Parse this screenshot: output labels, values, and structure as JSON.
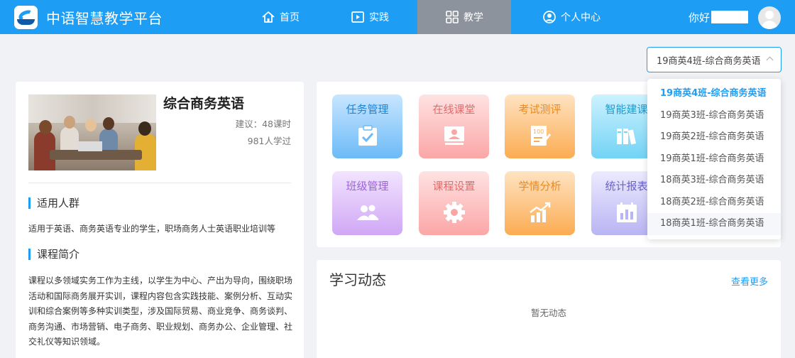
{
  "brand": {
    "title": "中语智慧教学平台",
    "logo_icon": "platform-logo"
  },
  "nav": [
    {
      "label": "首页",
      "icon": "home-icon"
    },
    {
      "label": "实践",
      "icon": "play-icon"
    },
    {
      "label": "教学",
      "icon": "grid-icon",
      "active": true
    },
    {
      "label": "个人中心",
      "icon": "user-circle-icon"
    }
  ],
  "user": {
    "greeting": "你好"
  },
  "class_select": {
    "value": "19商英4班-综合商务英语",
    "options": [
      "19商英4班-综合商务英语",
      "19商英3班-综合商务英语",
      "19商英2班-综合商务英语",
      "19商英1班-综合商务英语",
      "18商英3班-综合商务英语",
      "18商英2班-综合商务英语",
      "18商英1班-综合商务英语"
    ],
    "hovered_option": "18商英1班-综合商务英语"
  },
  "course": {
    "title": "综合商务英语",
    "hours": "建议：48课时",
    "learners": "981人学过",
    "audience_heading": "适用人群",
    "audience_text": "适用于英语、商务英语专业的学生，职场商务人士英语职业培训等",
    "intro_heading": "课程简介",
    "intro_text": "课程以多领域实务工作为主线，以学生为中心、产出为导向，围绕职场活动和国际商务展开实训，课程内容包含实践技能、案例分析、互动实训和综合案例等多种实训类型，涉及国际贸易、商业竞争、商务谈判、商务沟通、市场营销、电子商务、职业规划、商务办公、企业管理、社交礼仪等知识领域。"
  },
  "tools": [
    {
      "label": "任务管理",
      "icon": "clipboard-check-icon",
      "color": "#1a84d8"
    },
    {
      "label": "在线课堂",
      "icon": "online-class-icon",
      "color": "#e26b6b"
    },
    {
      "label": "考试测评",
      "icon": "exam-score-icon",
      "color": "#ea8a1f"
    },
    {
      "label": "智能建课",
      "icon": "books-icon",
      "color": "#2597c7"
    },
    {
      "label": "班级管理",
      "icon": "people-icon",
      "color": "#9a63d6"
    },
    {
      "label": "课程设置",
      "icon": "gear-icon",
      "color": "#e26b6b"
    },
    {
      "label": "学情分析",
      "icon": "growth-chart-icon",
      "color": "#ea8a1f"
    },
    {
      "label": "统计报表",
      "icon": "bar-report-icon",
      "color": "#6a62c8"
    }
  ],
  "activity": {
    "title": "学习动态",
    "more": "查看更多",
    "empty": "暂无动态"
  }
}
